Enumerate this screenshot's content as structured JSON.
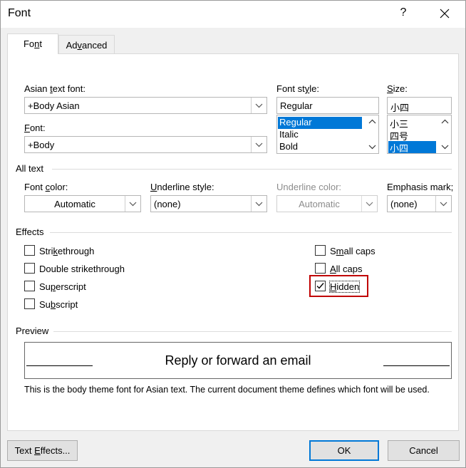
{
  "window": {
    "title": "Font",
    "help_label": "?"
  },
  "tabs": [
    {
      "label": "Font",
      "active": true
    },
    {
      "label": "Advanced",
      "active": false
    }
  ],
  "asian_font": {
    "label_pre": "Asian ",
    "label_u": "t",
    "label_post": "ext font:",
    "value": "+Body Asian"
  },
  "font": {
    "label_u": "F",
    "label_post": "ont:",
    "value": "+Body"
  },
  "font_style": {
    "label_pre": "Font st",
    "label_u": "y",
    "label_post": "le:",
    "value": "Regular",
    "options": [
      "Regular",
      "Italic",
      "Bold"
    ],
    "selected": "Regular"
  },
  "size": {
    "label_u": "S",
    "label_post": "ize:",
    "value": "小四",
    "options": [
      "小三",
      "四号",
      "小四"
    ],
    "selected": "小四"
  },
  "all_text": {
    "section_label": "All text",
    "font_color": {
      "label_pre": "Font ",
      "label_u": "c",
      "label_post": "olor:",
      "value": "Automatic"
    },
    "underline_style": {
      "label_u": "U",
      "label_post": "nderline style:",
      "value": "(none)"
    },
    "underline_color": {
      "label": "Underline color:",
      "value": "Automatic",
      "disabled": true
    },
    "emphasis_mark": {
      "label": "Emphasis mark;",
      "value": "(none)"
    }
  },
  "effects": {
    "section_label": "Effects",
    "left": [
      {
        "pre": "Stri",
        "u": "k",
        "post": "ethrough",
        "checked": false
      },
      {
        "pre": "Double strikethrou",
        "u": "g",
        "post": "h",
        "checked": false
      },
      {
        "pre": "Su",
        "u": "p",
        "post": "erscript",
        "checked": false
      },
      {
        "pre": "Su",
        "u": "b",
        "post": "script",
        "checked": false
      }
    ],
    "right": [
      {
        "pre": "S",
        "u": "m",
        "post": "all caps",
        "checked": false
      },
      {
        "pre": "",
        "u": "A",
        "post": "ll caps",
        "checked": false
      },
      {
        "pre": "",
        "u": "H",
        "post": "idden",
        "checked": true
      }
    ]
  },
  "preview": {
    "section_label": "Preview",
    "sample_text": "Reply or forward an email",
    "note": "This is the body theme font for Asian text. The current document theme defines which font will be used."
  },
  "buttons": {
    "text_effects": {
      "pre": "Text ",
      "u": "E",
      "post": "ffects..."
    },
    "ok": "OK",
    "cancel": "Cancel"
  },
  "colors": {
    "selection": "#0078d7",
    "highlight_frame": "#c00000",
    "dialog_bg": "#f0f0f0"
  }
}
